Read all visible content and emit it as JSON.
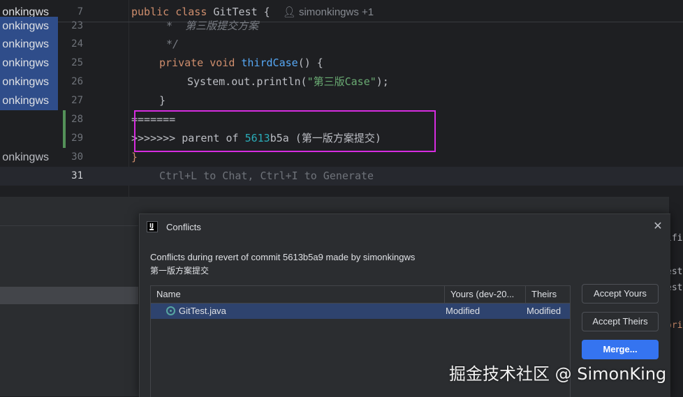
{
  "editor": {
    "rows": [
      {
        "blame": "onkingws",
        "num": "7",
        "kind": "class"
      },
      {
        "blame": "onkingws",
        "num": "23",
        "kind": "comment1"
      },
      {
        "blame": "onkingws",
        "num": "24",
        "kind": "comment2"
      },
      {
        "blame": "onkingws",
        "num": "25",
        "kind": "method"
      },
      {
        "blame": "onkingws",
        "num": "26",
        "kind": "println"
      },
      {
        "blame": "onkingws",
        "num": "27",
        "kind": "close"
      },
      {
        "blame": "",
        "num": "28",
        "kind": "sep"
      },
      {
        "blame": "",
        "num": "29",
        "kind": "marker"
      },
      {
        "blame": "onkingws",
        "num": "30",
        "kind": "brace"
      },
      {
        "blame": "",
        "num": "31",
        "kind": "hint"
      }
    ],
    "class_kw1": "public",
    "class_kw2": "class",
    "class_name": "GitTest {",
    "class_author": "simonkingws +1",
    "comment_line1": "*  第三版提交方案",
    "comment_line2": "*/",
    "method_kw1": "private",
    "method_kw2": "void",
    "method_name": "thirdCase",
    "method_rest": "() {",
    "println_call": "System.out.println(",
    "println_str": "\"第三版Case\"",
    "println_end": ");",
    "close_brace": "}",
    "separator": "=======",
    "marker_prefix": ">>>>>>> parent of ",
    "marker_hash": "5613",
    "marker_suffix": "b5a (第一版方案提交)",
    "brace": "}",
    "hint": "Ctrl+L to Chat, Ctrl+I to Generate"
  },
  "dialog": {
    "title": "Conflicts",
    "close_glyph": "✕",
    "message_line1": "Conflicts during revert of commit 5613b5a9 made by simonkingws",
    "message_line2": "第一版方案提交",
    "columns": [
      "Name",
      "Yours (dev-20...",
      "Theirs"
    ],
    "rows": [
      {
        "name": "GitTest.java",
        "yours": "Modified",
        "theirs": "Modified"
      }
    ],
    "buttons": {
      "accept_yours": "Accept Yours",
      "accept_theirs": "Accept Theirs",
      "merge": "Merge..."
    }
  },
  "right_strip": {
    "line1": "ified",
    "line2": "est.j",
    "line3": "est",
    "line4": "ori"
  },
  "watermark": "掘金技术社区 @ SimonKing",
  "colors": {
    "accent": "#3574f0",
    "annotation_box": "#d62ce0",
    "change_bar": "#549159",
    "selection": "#2e436e"
  }
}
